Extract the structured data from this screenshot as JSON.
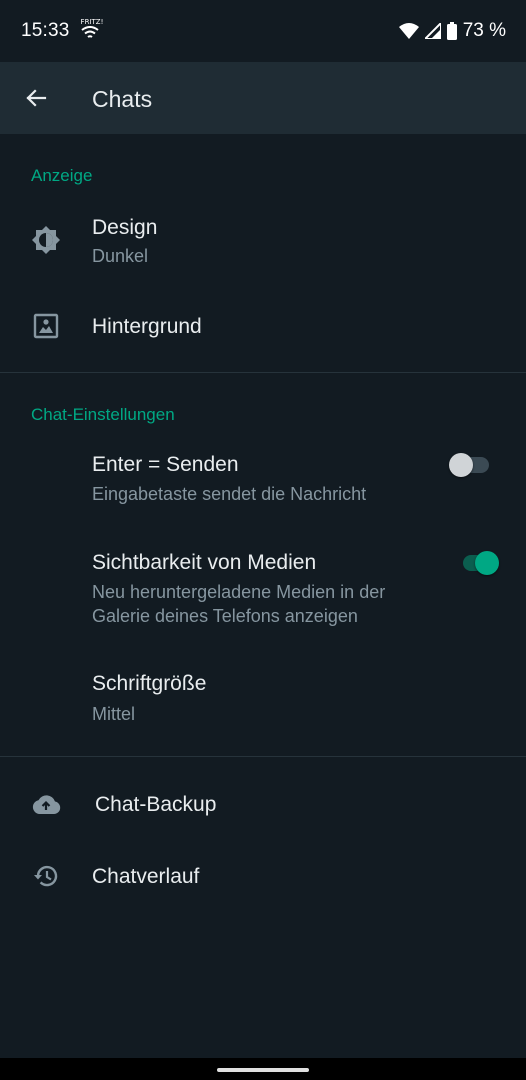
{
  "status_bar": {
    "time": "15:33",
    "fritz_label": "FRITZ!",
    "battery": "73 %"
  },
  "app_bar": {
    "title": "Chats",
    "back_icon": "arrow-back-icon"
  },
  "sections": {
    "display": {
      "header": "Anzeige",
      "design": {
        "title": "Design",
        "subtitle": "Dunkel",
        "icon": "brightness-icon"
      },
      "wallpaper": {
        "title": "Hintergrund",
        "icon": "wallpaper-icon"
      }
    },
    "chat_settings": {
      "header": "Chat-Einstellungen",
      "enter_send": {
        "title": "Enter = Senden",
        "subtitle": "Eingabetaste sendet die Nachricht",
        "enabled": false
      },
      "media_visibility": {
        "title": "Sichtbarkeit von Medien",
        "subtitle_line1": "Neu heruntergeladene Medien in der",
        "subtitle_line2": "Galerie deines Telefons anzeigen",
        "enabled": true
      },
      "font_size": {
        "title": "Schriftgröße",
        "subtitle": "Mittel"
      }
    },
    "other": {
      "backup": {
        "title": "Chat-Backup",
        "icon": "cloud-upload-icon"
      },
      "history": {
        "title": "Chatverlauf",
        "icon": "history-icon"
      }
    }
  },
  "colors": {
    "background": "#121b22",
    "app_bar": "#1f2c34",
    "accent": "#00a884",
    "primary_text": "#e9edef",
    "secondary_text": "#8696a0"
  }
}
